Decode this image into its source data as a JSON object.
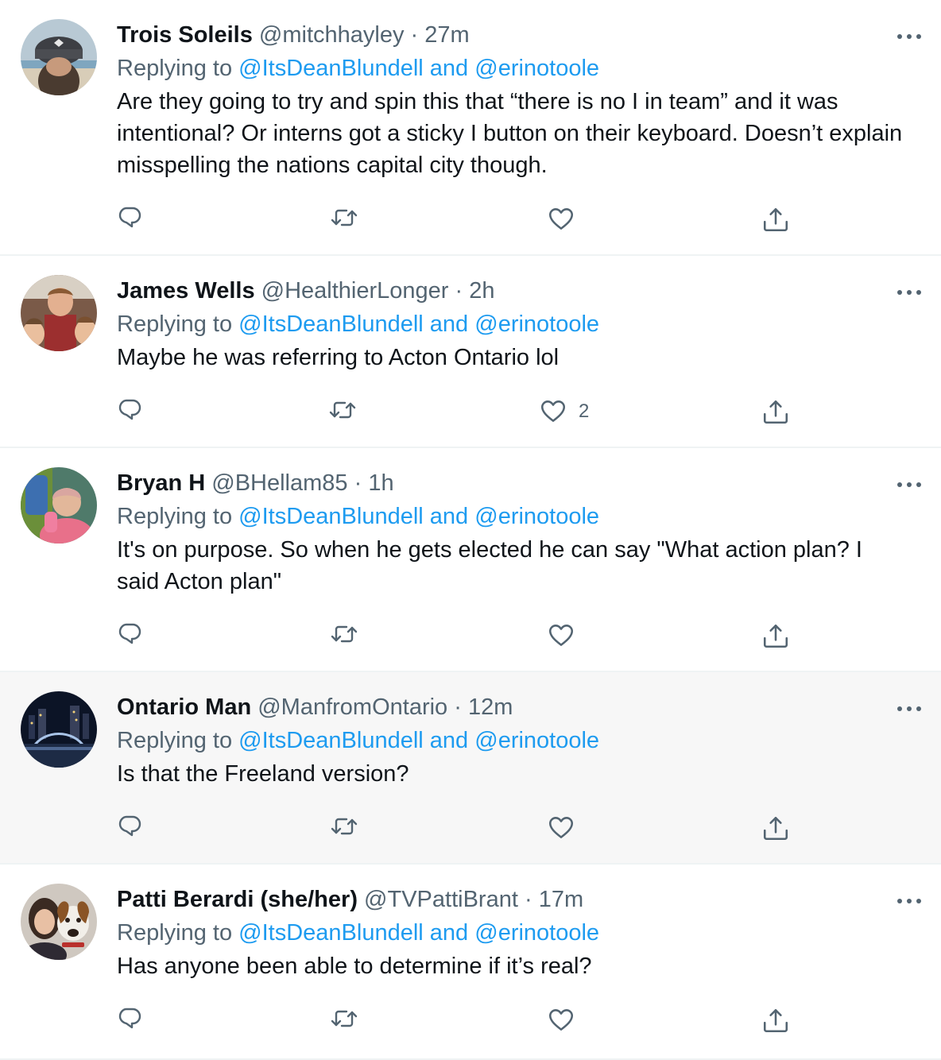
{
  "tweets": [
    {
      "name": "Trois Soleils",
      "handle": "@mitchhayley",
      "time": "27m",
      "replying_prefix": "Replying to",
      "mention1": "@ItsDeanBlundell",
      "and": "and",
      "mention2": "@erinotoole",
      "text": "Are they going to try and spin this that “there is no I in team” and it was intentional? Or interns got a sticky I button on their keyboard. Doesn’t explain misspelling the nations capital city though.",
      "likes": ""
    },
    {
      "name": "James Wells",
      "handle": "@HealthierLonger",
      "time": "2h",
      "replying_prefix": "Replying to",
      "mention1": "@ItsDeanBlundell",
      "and": "and",
      "mention2": "@erinotoole",
      "text": "Maybe he was referring to Acton Ontario lol",
      "likes": "2"
    },
    {
      "name": "Bryan H",
      "handle": "@BHellam85",
      "time": "1h",
      "replying_prefix": "Replying to",
      "mention1": "@ItsDeanBlundell",
      "and": "and",
      "mention2": "@erinotoole",
      "text": "It's on purpose. So when he gets elected he can say \"What action plan? I said Acton plan\"",
      "likes": ""
    },
    {
      "name": "Ontario Man",
      "handle": "@ManfromOntario",
      "time": "12m",
      "replying_prefix": "Replying to",
      "mention1": "@ItsDeanBlundell",
      "and": "and",
      "mention2": "@erinotoole",
      "text": "Is that the Freeland version?",
      "likes": ""
    },
    {
      "name": "Patti Berardi (she/her)",
      "handle": "@TVPattiBrant",
      "time": "17m",
      "replying_prefix": "Replying to",
      "mention1": "@ItsDeanBlundell",
      "and": "and",
      "mention2": "@erinotoole",
      "text": "Has anyone been able to determine if it’s real?",
      "likes": ""
    }
  ],
  "separator": "·",
  "icons": {
    "reply": "reply-icon",
    "retweet": "retweet-icon",
    "like": "like-icon",
    "share": "share-icon",
    "more": "more-icon"
  },
  "colors": {
    "link": "#1d9bf0",
    "secondary_text": "#536471",
    "highlight_background": "#f7f7f7"
  }
}
